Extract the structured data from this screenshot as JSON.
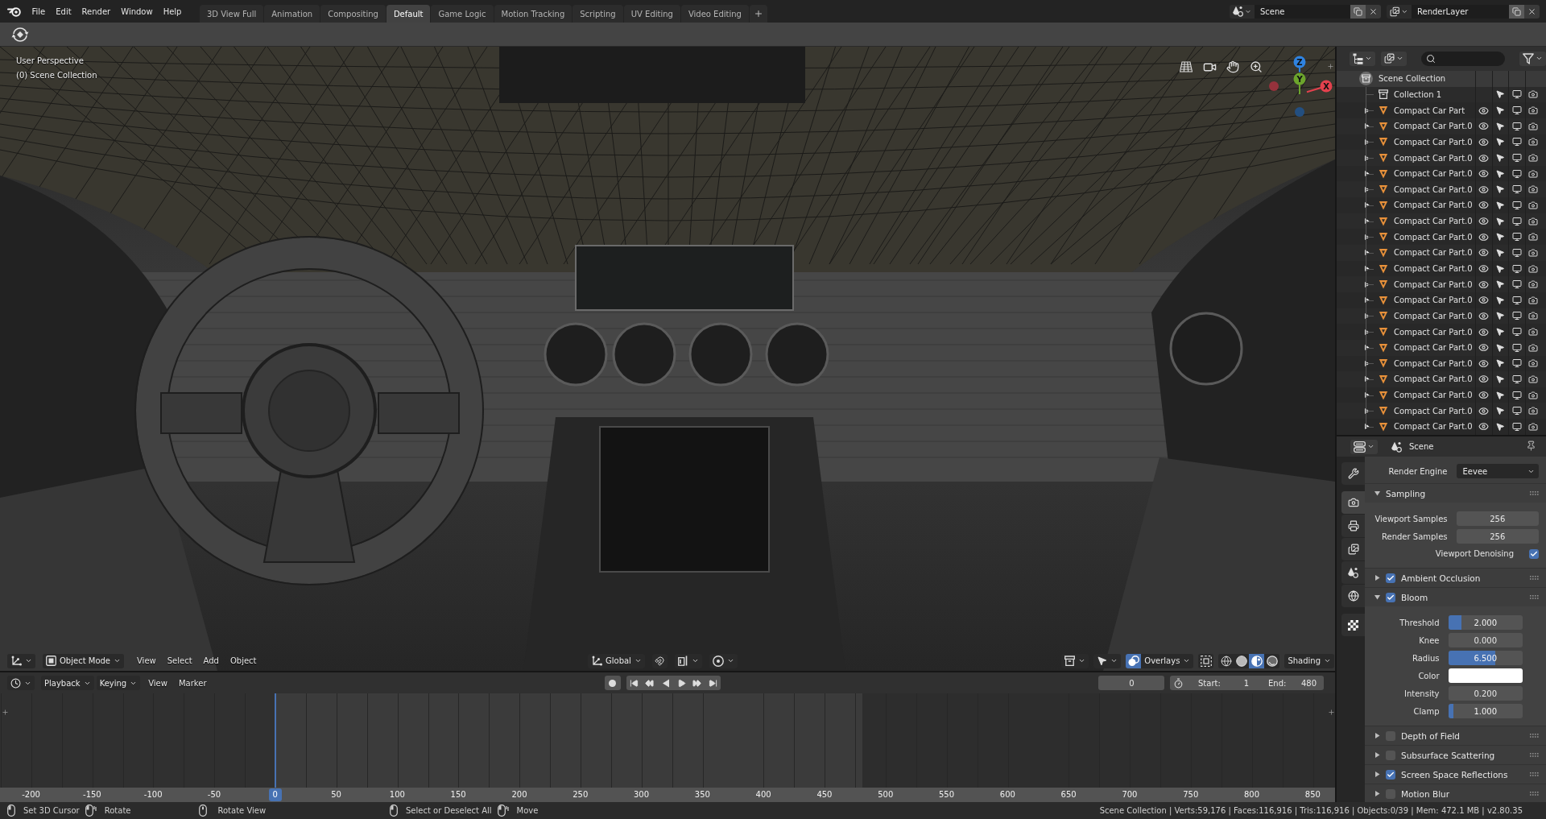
{
  "topbar": {
    "menus": [
      "File",
      "Edit",
      "Render",
      "Window",
      "Help"
    ],
    "workspaces": [
      {
        "label": "3D View Full",
        "selected": false
      },
      {
        "label": "Animation",
        "selected": false
      },
      {
        "label": "Compositing",
        "selected": false
      },
      {
        "label": "Default",
        "selected": true
      },
      {
        "label": "Game Logic",
        "selected": false
      },
      {
        "label": "Motion Tracking",
        "selected": false
      },
      {
        "label": "Scripting",
        "selected": false
      },
      {
        "label": "UV Editing",
        "selected": false
      },
      {
        "label": "Video Editing",
        "selected": false
      }
    ],
    "scene": "Scene",
    "view_layer": "RenderLayer"
  },
  "viewport": {
    "view_name": "User Perspective",
    "collection": "(0) Scene Collection",
    "gizmo_axes": [
      {
        "kind": "z",
        "label": "Z"
      },
      {
        "kind": "y",
        "label": "Y"
      },
      {
        "kind": "x",
        "label": "X"
      }
    ],
    "header": {
      "mode": "Object Mode",
      "menus": [
        "View",
        "Select",
        "Add",
        "Object"
      ],
      "orientation": "Global",
      "overlays": {
        "label": "Overlays",
        "on": true
      },
      "xray": false,
      "shading": {
        "label": "Shading",
        "modes": [
          {
            "kind": "wireframe",
            "selected": false
          },
          {
            "kind": "solid",
            "selected": false
          },
          {
            "kind": "material",
            "selected": true
          },
          {
            "kind": "rendered",
            "selected": false
          }
        ]
      }
    }
  },
  "timeline": {
    "dropdowns": [
      "Playback",
      "Keying"
    ],
    "menus": [
      "View",
      "Marker"
    ],
    "current_frame": "0",
    "start": {
      "label": "Start:",
      "value": "1"
    },
    "end": {
      "label": "End:",
      "value": "480"
    },
    "ruler": [
      {
        "label": "-200",
        "current": false
      },
      {
        "label": "-150",
        "current": false
      },
      {
        "label": "-100",
        "current": false
      },
      {
        "label": "-50",
        "current": false
      },
      {
        "label": "0",
        "current": true
      },
      {
        "label": "50",
        "current": false
      },
      {
        "label": "100",
        "current": false
      },
      {
        "label": "150",
        "current": false
      },
      {
        "label": "200",
        "current": false
      },
      {
        "label": "250",
        "current": false
      },
      {
        "label": "300",
        "current": false
      },
      {
        "label": "350",
        "current": false
      },
      {
        "label": "400",
        "current": false
      },
      {
        "label": "450",
        "current": false
      },
      {
        "label": "500",
        "current": false
      },
      {
        "label": "550",
        "current": false
      },
      {
        "label": "600",
        "current": false
      },
      {
        "label": "650",
        "current": false
      },
      {
        "label": "700",
        "current": false
      },
      {
        "label": "750",
        "current": false
      },
      {
        "label": "800",
        "current": false
      },
      {
        "label": "850",
        "current": false
      }
    ]
  },
  "outliner": {
    "tree": {
      "name": "Scene Collection",
      "active": true,
      "children": [
        {
          "name": "Collection 1",
          "kind": "collection",
          "selectable": true,
          "viewport": true,
          "renderable": true
        },
        {
          "name": "Compact Car Part",
          "kind": "mesh",
          "expanded": false,
          "visible": true,
          "selectable": true,
          "viewport": true,
          "renderable": true
        },
        {
          "name": "Compact Car Part.0",
          "kind": "mesh",
          "expanded": false,
          "visible": true,
          "selectable": true,
          "viewport": true,
          "renderable": true
        },
        {
          "name": "Compact Car Part.0",
          "kind": "mesh",
          "expanded": false,
          "visible": true,
          "selectable": true,
          "viewport": true,
          "renderable": true
        },
        {
          "name": "Compact Car Part.0",
          "kind": "mesh",
          "expanded": false,
          "visible": true,
          "selectable": true,
          "viewport": true,
          "renderable": true
        },
        {
          "name": "Compact Car Part.0",
          "kind": "mesh",
          "expanded": false,
          "visible": true,
          "selectable": true,
          "viewport": true,
          "renderable": true
        },
        {
          "name": "Compact Car Part.0",
          "kind": "mesh",
          "expanded": false,
          "visible": true,
          "selectable": true,
          "viewport": true,
          "renderable": true
        },
        {
          "name": "Compact Car Part.0",
          "kind": "mesh",
          "expanded": false,
          "visible": true,
          "selectable": true,
          "viewport": true,
          "renderable": true
        },
        {
          "name": "Compact Car Part.0",
          "kind": "mesh",
          "expanded": false,
          "visible": true,
          "selectable": true,
          "viewport": true,
          "renderable": true
        },
        {
          "name": "Compact Car Part.0",
          "kind": "mesh",
          "expanded": false,
          "visible": true,
          "selectable": true,
          "viewport": true,
          "renderable": true
        },
        {
          "name": "Compact Car Part.0",
          "kind": "mesh",
          "expanded": false,
          "visible": true,
          "selectable": true,
          "viewport": true,
          "renderable": true
        },
        {
          "name": "Compact Car Part.0",
          "kind": "mesh",
          "expanded": false,
          "visible": true,
          "selectable": true,
          "viewport": true,
          "renderable": true
        },
        {
          "name": "Compact Car Part.0",
          "kind": "mesh",
          "expanded": false,
          "visible": true,
          "selectable": true,
          "viewport": true,
          "renderable": true
        },
        {
          "name": "Compact Car Part.0",
          "kind": "mesh",
          "expanded": false,
          "visible": true,
          "selectable": true,
          "viewport": true,
          "renderable": true
        },
        {
          "name": "Compact Car Part.0",
          "kind": "mesh",
          "expanded": false,
          "visible": true,
          "selectable": true,
          "viewport": true,
          "renderable": true
        },
        {
          "name": "Compact Car Part.0",
          "kind": "mesh",
          "expanded": false,
          "visible": true,
          "selectable": true,
          "viewport": true,
          "renderable": true
        },
        {
          "name": "Compact Car Part.0",
          "kind": "mesh",
          "expanded": false,
          "visible": true,
          "selectable": true,
          "viewport": true,
          "renderable": true
        },
        {
          "name": "Compact Car Part.0",
          "kind": "mesh",
          "expanded": false,
          "visible": true,
          "selectable": true,
          "viewport": true,
          "renderable": true
        },
        {
          "name": "Compact Car Part.0",
          "kind": "mesh",
          "expanded": false,
          "visible": true,
          "selectable": true,
          "viewport": true,
          "renderable": true
        },
        {
          "name": "Compact Car Part.0",
          "kind": "mesh",
          "expanded": false,
          "visible": true,
          "selectable": true,
          "viewport": true,
          "renderable": true
        },
        {
          "name": "Compact Car Part.0",
          "kind": "mesh",
          "expanded": false,
          "visible": true,
          "selectable": true,
          "viewport": true,
          "renderable": true
        },
        {
          "name": "Compact Car Part.0",
          "kind": "mesh",
          "expanded": false,
          "visible": true,
          "selectable": true,
          "viewport": true,
          "renderable": true
        }
      ]
    }
  },
  "properties": {
    "context": "Scene",
    "tab_groups": [
      [
        {
          "kind": "tool",
          "selected": false
        }
      ],
      [
        {
          "kind": "render",
          "selected": true
        },
        {
          "kind": "output",
          "selected": false
        },
        {
          "kind": "view_layer",
          "selected": false
        },
        {
          "kind": "scene",
          "selected": false
        },
        {
          "kind": "world",
          "selected": false
        }
      ],
      [
        {
          "kind": "texture",
          "selected": false
        }
      ]
    ],
    "render_engine": {
      "label": "Render Engine",
      "value": "Eevee"
    },
    "panels": [
      {
        "title": "Sampling",
        "expanded": true,
        "fields": [
          {
            "kind": "number",
            "label": "Viewport Samples",
            "value": "256"
          },
          {
            "kind": "number",
            "label": "Render Samples",
            "value": "256"
          },
          {
            "kind": "check",
            "label": "Viewport Denoising",
            "checked": true
          }
        ]
      },
      {
        "title": "Ambient Occlusion",
        "expanded": false,
        "enabled": true
      },
      {
        "title": "Bloom",
        "expanded": true,
        "enabled": true,
        "fields": [
          {
            "kind": "slider",
            "label": "Threshold",
            "value": "2.000",
            "level": 0.18
          },
          {
            "kind": "number",
            "label": "Knee",
            "value": "0.000"
          },
          {
            "kind": "slider",
            "label": "Radius",
            "value": "6.500",
            "level": 0.63
          },
          {
            "kind": "color",
            "label": "Color",
            "color": "#ffffff"
          },
          {
            "kind": "number",
            "label": "Intensity",
            "value": "0.200"
          },
          {
            "kind": "slider",
            "label": "Clamp",
            "value": "1.000",
            "level": 0.07
          }
        ]
      },
      {
        "title": "Depth of Field",
        "expanded": false,
        "enabled": false
      },
      {
        "title": "Subsurface Scattering",
        "expanded": false,
        "enabled": false
      },
      {
        "title": "Screen Space Reflections",
        "expanded": false,
        "enabled": true
      },
      {
        "title": "Motion Blur",
        "expanded": false,
        "enabled": false
      }
    ]
  },
  "status_bar": {
    "hint_groups": [
      [
        {
          "kind": "click",
          "label": "Set 3D Cursor"
        },
        {
          "kind": "drag",
          "label": "Rotate"
        }
      ],
      [
        {
          "kind": "middle",
          "label": "Rotate View"
        }
      ],
      [
        {
          "kind": "click",
          "label": "Select or Deselect All"
        },
        {
          "kind": "drag",
          "label": "Move"
        }
      ]
    ],
    "stats": "Scene Collection | Verts:59,176 | Faces:116,916 | Tris:116,916 | Objects:0/39 | Mem: 472.1 MB | v2.80.35"
  }
}
